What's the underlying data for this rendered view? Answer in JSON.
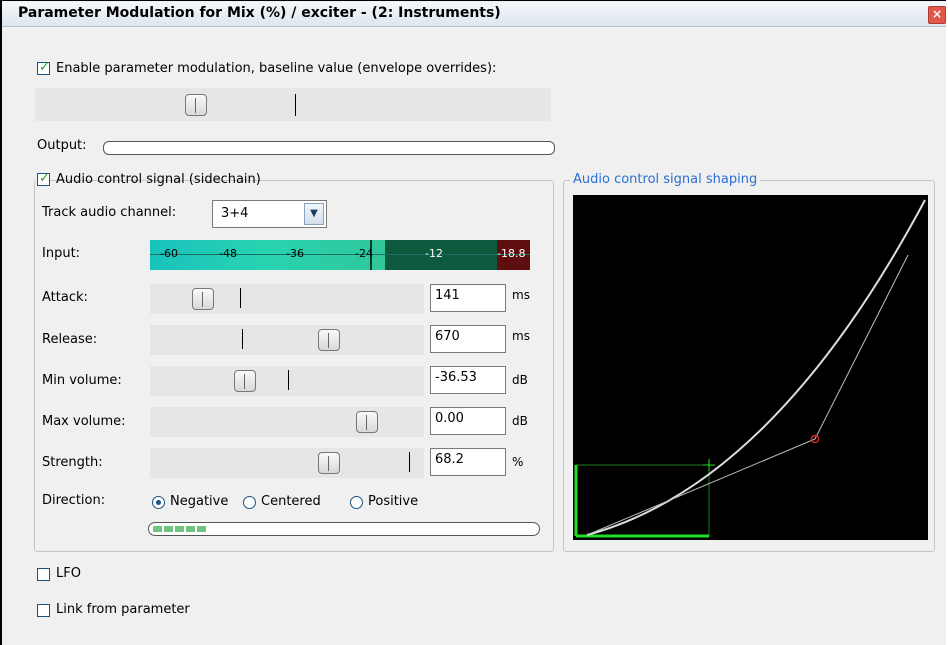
{
  "window": {
    "title": "Parameter Modulation for Mix (%) / exciter - (2: Instruments)"
  },
  "enable": {
    "label": "Enable parameter modulation, baseline value (envelope overrides):",
    "checked": true
  },
  "output": {
    "label": "Output:"
  },
  "audio_control": {
    "label": "Audio control signal (sidechain)",
    "checked": true,
    "track_channel": {
      "label": "Track audio channel:",
      "value": "3+4"
    },
    "input": {
      "label": "Input:",
      "ticks": [
        "-60",
        "-48",
        "-36",
        "-24",
        "-12"
      ],
      "peak": "-18.8"
    },
    "attack": {
      "label": "Attack:",
      "value": "141",
      "unit": "ms"
    },
    "release": {
      "label": "Release:",
      "value": "670",
      "unit": "ms"
    },
    "min_volume": {
      "label": "Min volume:",
      "value": "-36.53",
      "unit": "dB"
    },
    "max_volume": {
      "label": "Max volume:",
      "value": "0.00",
      "unit": "dB"
    },
    "strength": {
      "label": "Strength:",
      "value": "68.2",
      "unit": "%"
    },
    "direction": {
      "label": "Direction:",
      "options": [
        "Negative",
        "Centered",
        "Positive"
      ],
      "selected": "Negative"
    }
  },
  "shaping": {
    "label": "Audio control signal shaping"
  },
  "lfo": {
    "label": "LFO",
    "checked": false
  },
  "link": {
    "label": "Link from parameter",
    "checked": false
  },
  "colors": {
    "accent_blue": "#2a6fd6",
    "meter_teal": "#19c6b4",
    "meter_dark_green": "#0b5e3c",
    "meter_red": "#6b0f0f",
    "curve_green": "#22dd22"
  }
}
